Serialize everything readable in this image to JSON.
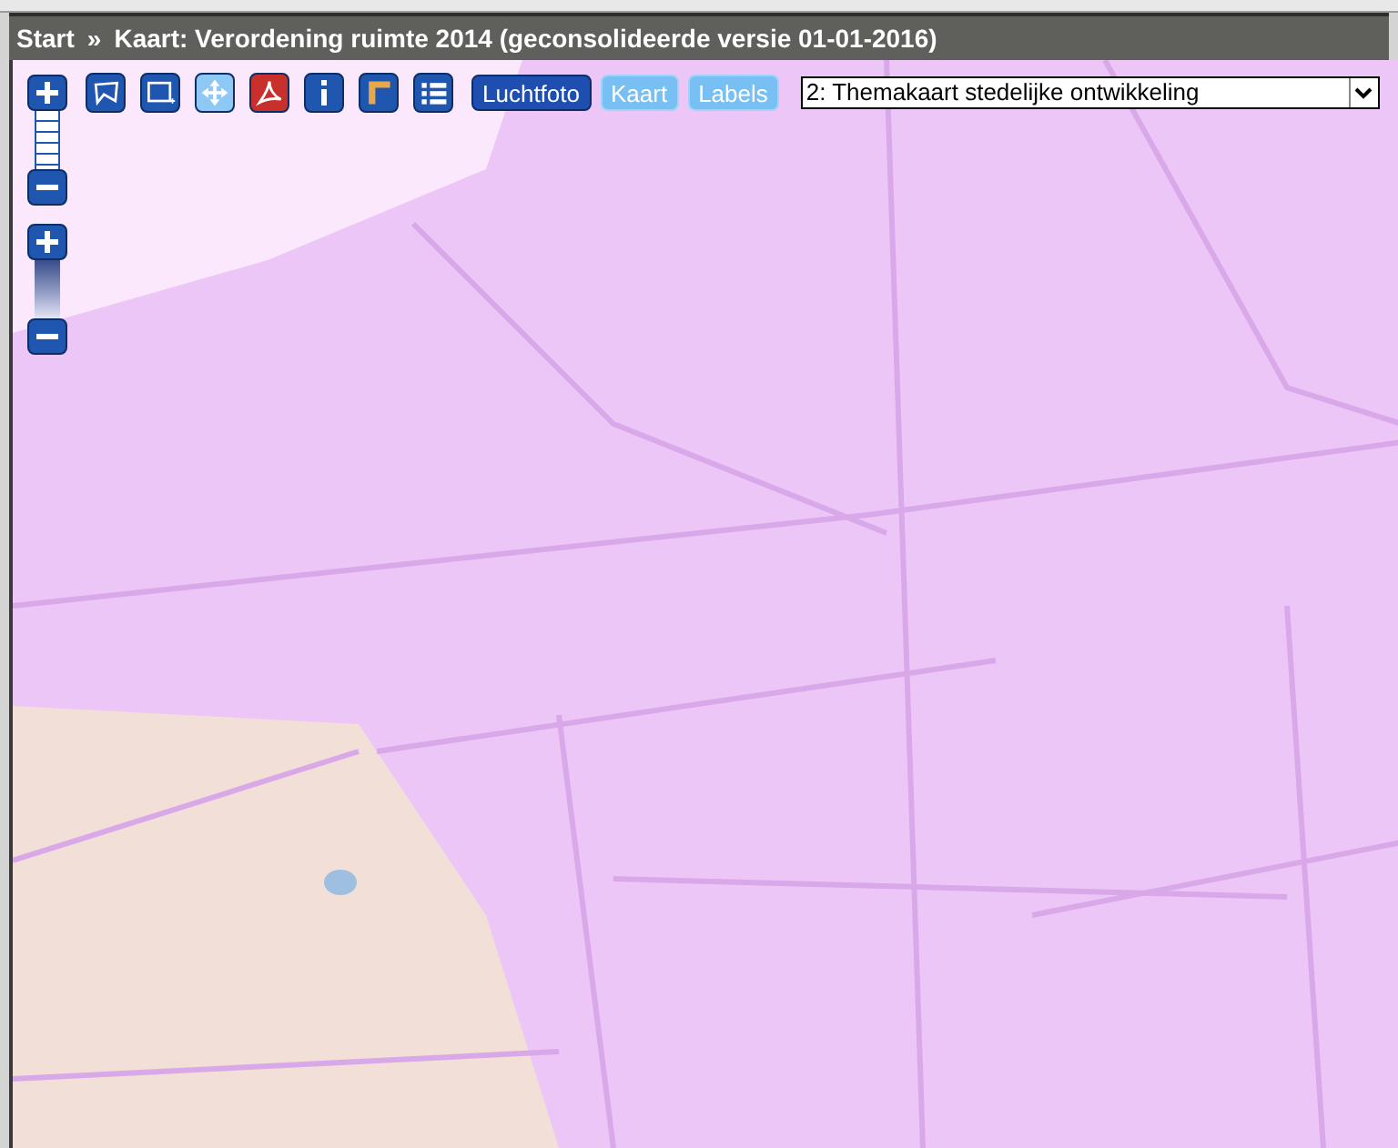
{
  "breadcrumb": {
    "link": "Start",
    "separator": "»",
    "title": "Kaart: Verordening ruimte 2014 (geconsolideerde versie 01-01-2016)"
  },
  "tools": [
    {
      "kind": "polygon",
      "selected": false
    },
    {
      "kind": "rectangle",
      "selected": false
    },
    {
      "kind": "pan",
      "selected": true
    },
    {
      "kind": "pdf",
      "selected": false
    },
    {
      "kind": "info",
      "selected": false
    },
    {
      "kind": "measure",
      "selected": false
    },
    {
      "kind": "legend",
      "selected": false
    }
  ],
  "layers": [
    {
      "label": "Luchtfoto",
      "selected": true
    },
    {
      "label": "Kaart",
      "selected": false
    },
    {
      "label": "Labels",
      "selected": false
    }
  ],
  "map_select": {
    "value": "2: Themakaart stedelijke ontwikkeling"
  },
  "zoom_controls": [
    {
      "kind": "ladder"
    },
    {
      "kind": "gradient"
    }
  ]
}
